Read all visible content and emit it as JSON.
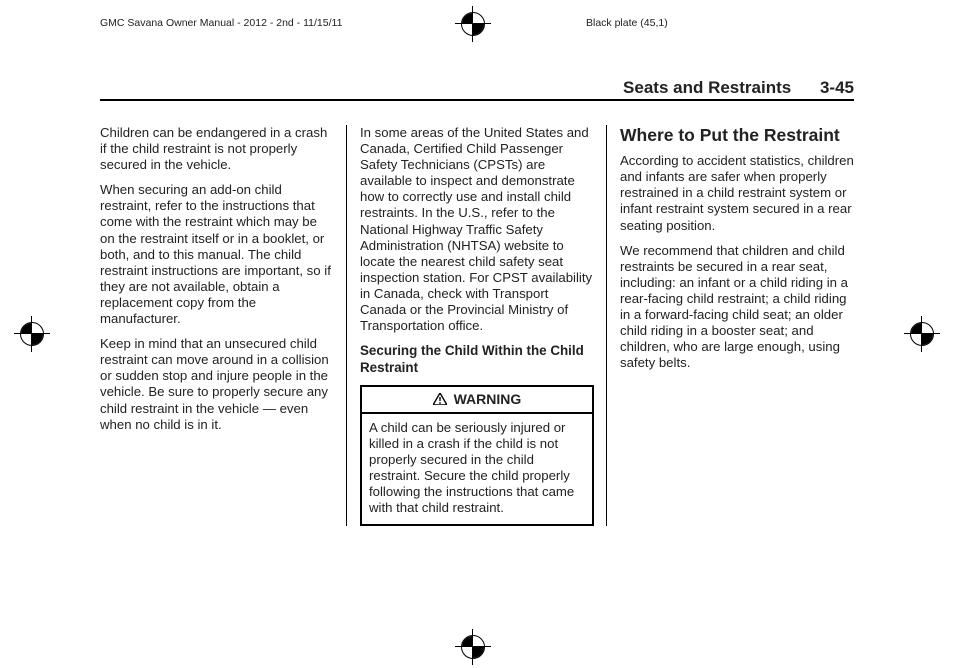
{
  "meta": {
    "left_header": "GMC Savana Owner Manual - 2012 - 2nd - 11/15/11",
    "right_header": "Black plate (45,1)"
  },
  "header": {
    "section": "Seats and Restraints",
    "page": "3-45"
  },
  "columns": {
    "col1": {
      "p1": "Children can be endangered in a crash if the child restraint is not properly secured in the vehicle.",
      "p2": "When securing an add-on child restraint, refer to the instructions that come with the restraint which may be on the restraint itself or in a booklet, or both, and to this manual. The child restraint instructions are important, so if they are not available, obtain a replacement copy from the manufacturer.",
      "p3": "Keep in mind that an unsecured child restraint can move around in a collision or sudden stop and injure people in the vehicle. Be sure to properly secure any child restraint in the vehicle — even when no child is in it."
    },
    "col2": {
      "p1": "In some areas of the United States and Canada, Certified Child Passenger Safety Technicians (CPSTs) are available to inspect and demonstrate how to correctly use and install child restraints. In the U.S., refer to the National Highway Traffic Safety Administration (NHTSA) website to locate the nearest child safety seat inspection station. For CPST availability in Canada, check with Transport Canada or the Provincial Ministry of Transportation office.",
      "subhead": "Securing the Child Within the Child Restraint",
      "warning_label": "WARNING",
      "warning_body": "A child can be seriously injured or killed in a crash if the child is not properly secured in the child restraint. Secure the child properly following the instructions that came with that child restraint."
    },
    "col3": {
      "h2": "Where to Put the Restraint",
      "p1": "According to accident statistics, children and infants are safer when properly restrained in a child restraint system or infant restraint system secured in a rear seating position.",
      "p2": "We recommend that children and child restraints be secured in a rear seat, including: an infant or a child riding in a rear-facing child restraint; a child riding in a forward-facing child seat; an older child riding in a booster seat; and children, who are large enough, using safety belts."
    }
  }
}
